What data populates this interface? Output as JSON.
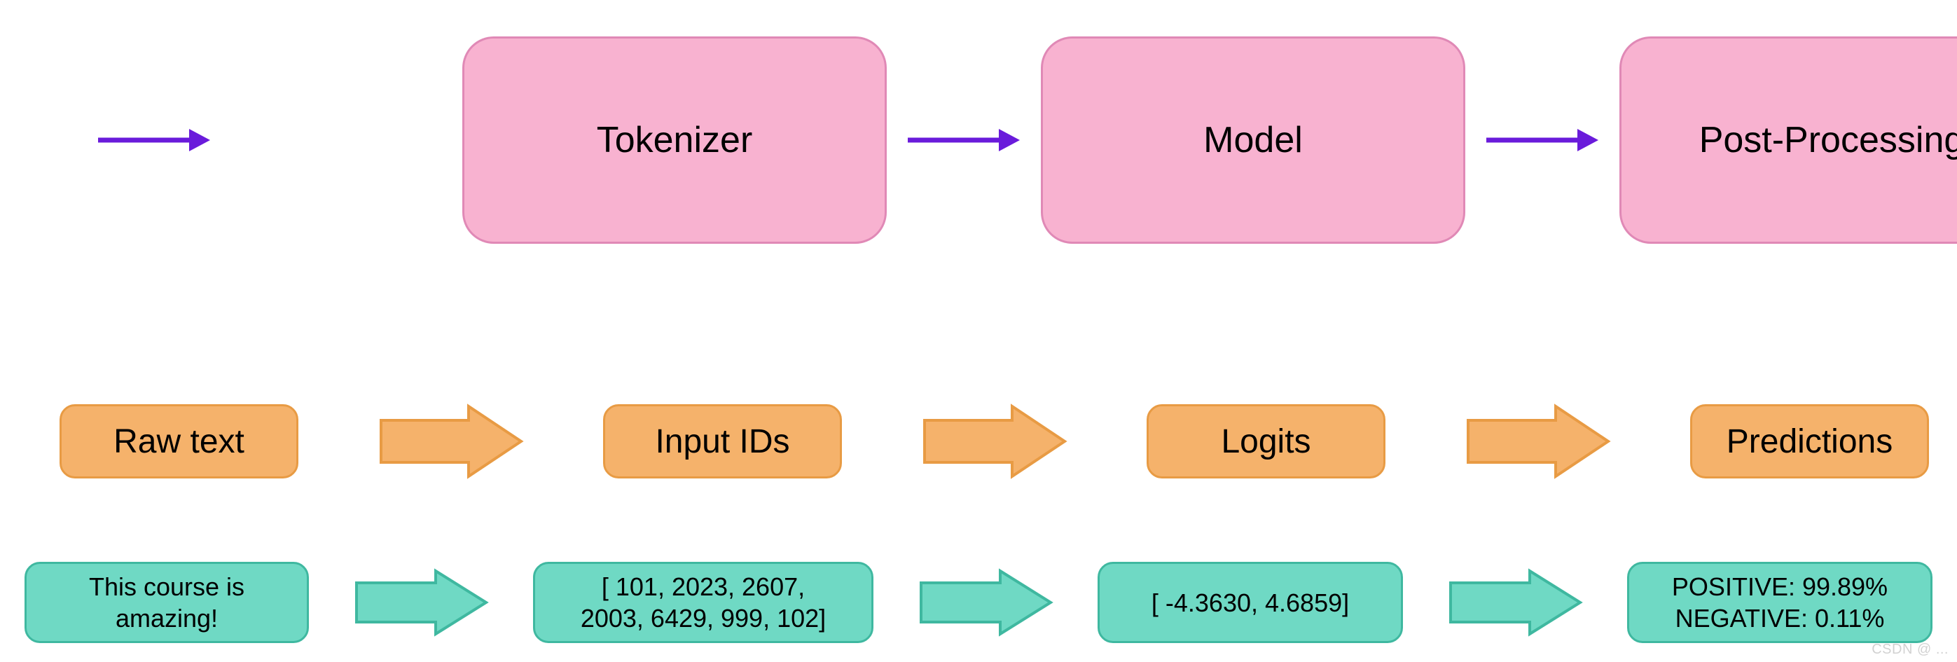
{
  "pipeline": {
    "stage1": "Tokenizer",
    "stage2": "Model",
    "stage3": "Post-Processing"
  },
  "labels": {
    "raw": "Raw text",
    "input_ids": "Input IDs",
    "logits": "Logits",
    "predictions": "Predictions"
  },
  "example": {
    "raw_line1": "This course is",
    "raw_line2": "amazing!",
    "ids_line1": "[ 101, 2023, 2607,",
    "ids_line2": "2003, 6429, 999, 102]",
    "logits": "[ -4.3630, 4.6859]",
    "pred_line1": "POSITIVE: 99.89%",
    "pred_line2": "NEGATIVE:  0.11%"
  },
  "colors": {
    "pink_fill": "#F8B2D0",
    "pink_border": "#E089B6",
    "orange_fill": "#F5B26B",
    "orange_border": "#E89B44",
    "teal_fill": "#6FD9C4",
    "teal_border": "#3FB8A0",
    "purple": "#6A1BDB"
  },
  "watermark": "CSDN @ ..."
}
